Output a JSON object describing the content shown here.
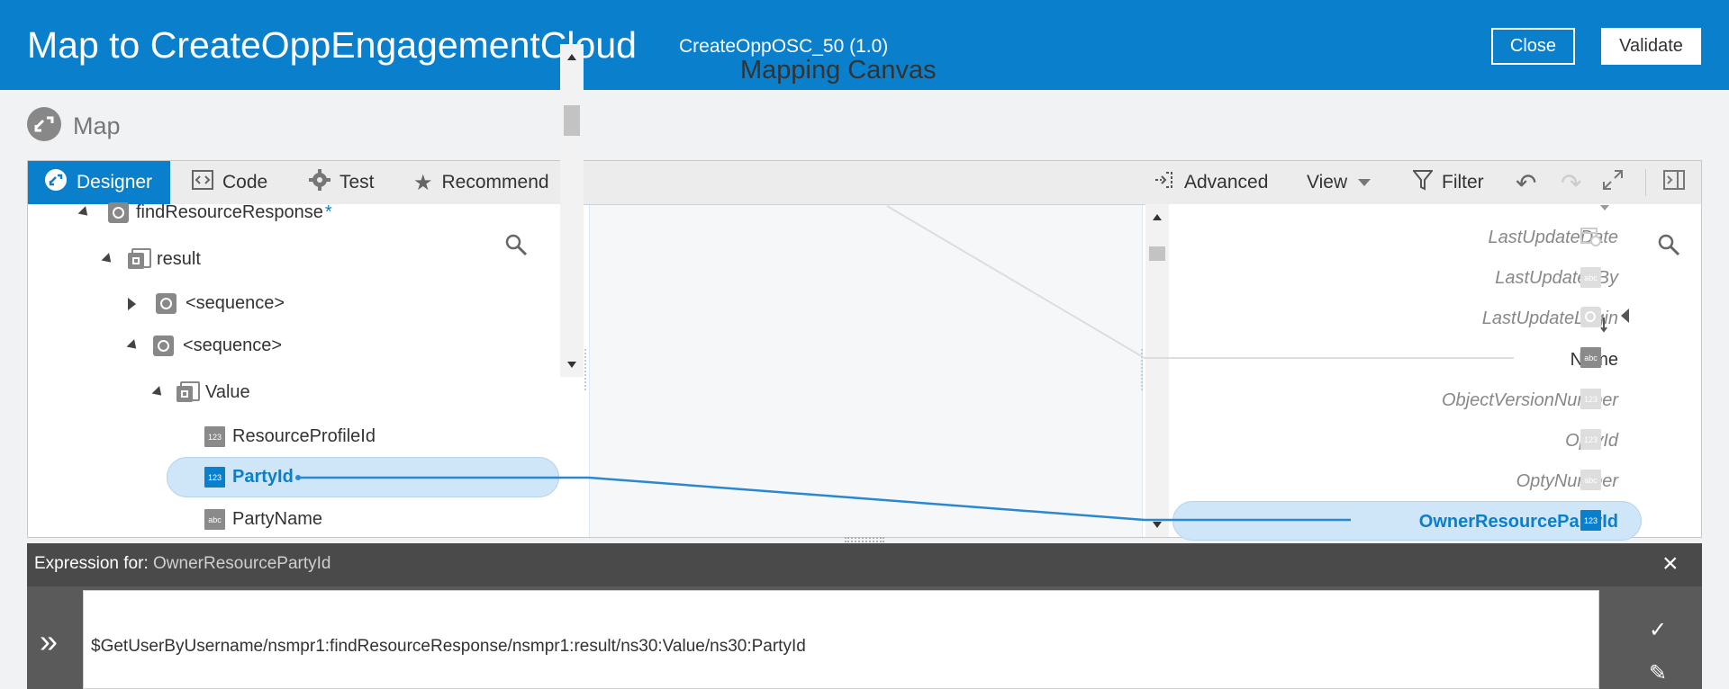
{
  "header": {
    "title": "Map to CreateOppEngagementCloud",
    "subtitle": "CreateOppOSC_50 (1.0)",
    "close_label": "Close",
    "validate_label": "Validate"
  },
  "breadcrumb": {
    "label": "Map"
  },
  "toolbar": {
    "designer": "Designer",
    "code": "Code",
    "test": "Test",
    "recommend": "Recommend",
    "advanced": "Advanced",
    "view": "View",
    "filter": "Filter"
  },
  "source_tree": {
    "root": "findResourceResponse",
    "root_marker": "*",
    "result": "result",
    "sequence_1": "<sequence>",
    "sequence_2": "<sequence>",
    "value": "Value",
    "resource_profile_id": "ResourceProfileId",
    "party_id": "PartyId",
    "party_name": "PartyName",
    "type_num": "123",
    "type_str": "abc"
  },
  "canvas": {
    "title": "Mapping Canvas"
  },
  "target_tree": {
    "items": [
      {
        "label": "LastUpdateDate",
        "state": "faded"
      },
      {
        "label": "LastUpdatedBy",
        "state": "faded"
      },
      {
        "label": "LastUpdateLogin",
        "state": "faded"
      },
      {
        "label": "Name",
        "state": "mapped"
      },
      {
        "label": "ObjectVersionNumber",
        "state": "faded"
      },
      {
        "label": "OptyId",
        "state": "faded"
      },
      {
        "label": "OptyNumber",
        "state": "faded"
      },
      {
        "label": "OwnerResourcePartyId",
        "state": "selected"
      }
    ],
    "type_num": "123",
    "type_str": "abc"
  },
  "expression": {
    "prefix": "Expression for:",
    "target": "OwnerResourcePartyId",
    "value": "$GetUserByUsername/nsmpr1:findResourceResponse/nsmpr1:result/ns30:Value/ns30:PartyId"
  },
  "colors": {
    "brand": "#0a7fcb",
    "selection": "#cfe5f8",
    "expr_bar": "#4a4a4a"
  }
}
